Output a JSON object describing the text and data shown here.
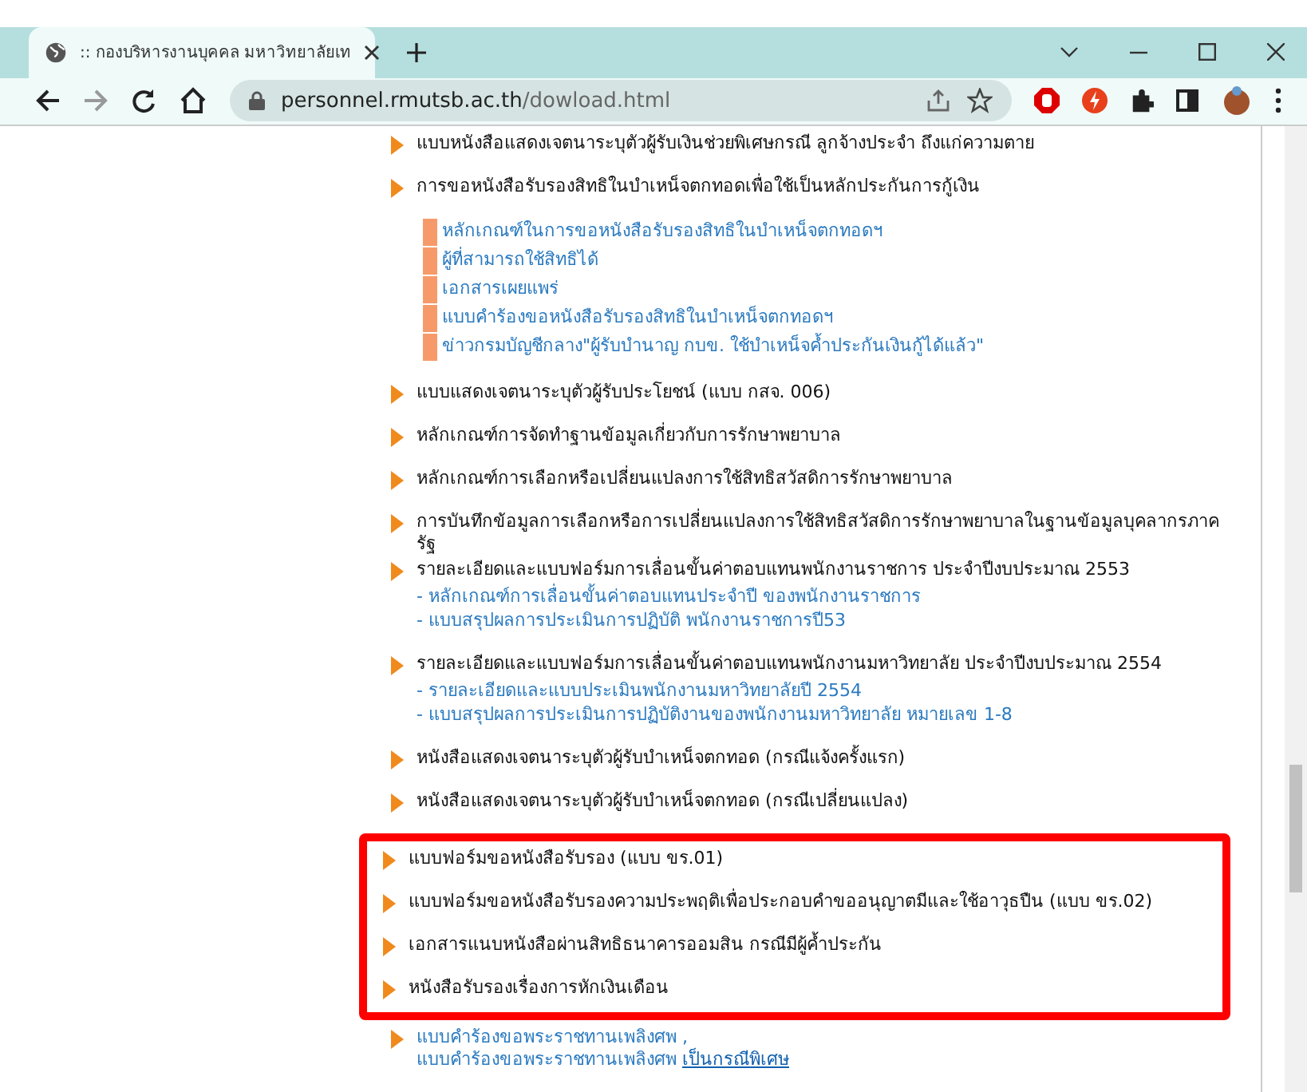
{
  "browser": {
    "tab_title": ":: กองบริหารงานบุคคล มหาวิทยาลัยเท",
    "url_host": "personnel.rmutsb.ac.th",
    "url_path": "/dowload.html",
    "forward_disabled": true
  },
  "items": [
    {
      "kind": "text",
      "highlighted": false,
      "lines": [
        "แบบหนังสือแสดงเจตนาระบุตัวผู้รับเงินช่วยพิเศษกรณี ลูกจ้างประจำ ถึงแก่ความตาย"
      ]
    },
    {
      "kind": "text",
      "highlighted": false,
      "lines": [
        "การขอหนังสือรับรองสิทธิในบำเหน็จตกทอดเพื่อใช้เป็นหลักประกันการกู้เงิน"
      ],
      "sublinks": [
        {
          "kind": "bar",
          "text": "หลักเกณฑ์ในการขอหนังสือรับรองสิทธิในบำเหน็จตกทอดฯ"
        },
        {
          "kind": "bar",
          "text": "ผู้ที่สามารถใช้สิทธิได้"
        },
        {
          "kind": "bar",
          "text": "เอกสารเผยแพร่"
        },
        {
          "kind": "bar",
          "text": "แบบคำร้องขอหนังสือรับรองสิทธิในบำเหน็จตกทอดฯ"
        },
        {
          "kind": "bar",
          "text": "ข่าวกรมบัญชีกลาง\"ผู้รับบำนาญ กบข. ใช้บำเหน็จค้ำประกันเงินกู้ได้แล้ว\""
        }
      ]
    },
    {
      "kind": "text",
      "highlighted": false,
      "lines": [
        "แบบแสดงเจตนาระบุตัวผู้รับประโยชน์ (แบบ กสจ. 006)"
      ]
    },
    {
      "kind": "text",
      "highlighted": false,
      "lines": [
        "หลักเกณฑ์การจัดทำฐานข้อมูลเกี่ยวกับการรักษาพยาบาล"
      ]
    },
    {
      "kind": "text",
      "highlighted": false,
      "lines": [
        "หลักเกณฑ์การเลือกหรือเปลี่ยนแปลงการใช้สิทธิสวัสดิการรักษาพยาบาล"
      ]
    },
    {
      "kind": "text",
      "highlighted": false,
      "lines": [
        "การบันทึกข้อมูลการเลือกหรือการเปลี่ยนแปลงการใช้สิทธิสวัสดิการรักษาพยาบาลในฐานข้อมูลบุคลากรภาค",
        "รัฐ"
      ]
    },
    {
      "kind": "text",
      "highlighted": false,
      "lines": [
        "รายละเอียดและแบบฟอร์มการเลื่อนขั้นค่าตอบแทนพนักงานราชการ ประจำปีงบประมาณ 2553"
      ],
      "sublinks": [
        {
          "kind": "dash",
          "text": "- หลักเกณฑ์การเลื่อนขั้นค่าตอบแทนประจำปี ของพนักงานราชการ"
        },
        {
          "kind": "dash",
          "text": "- แบบสรุปผลการประเมินการปฏิบัติ พนักงานราชการปี53"
        }
      ]
    },
    {
      "kind": "text",
      "highlighted": false,
      "lines": [
        "รายละเอียดและแบบฟอร์มการเลื่อนขั้นค่าตอบแทนพนักงานมหาวิทยาลัย ประจำปีงบประมาณ 2554"
      ],
      "sublinks": [
        {
          "kind": "dash",
          "text": "- รายละเอียดและแบบประเมินพนักงานมหาวิทยาลัยปี 2554"
        },
        {
          "kind": "dash",
          "text": "- แบบสรุปผลการประเมินการปฏิบัติงานของพนักงานมหาวิทยาลัย หมายเลข 1-8"
        }
      ]
    },
    {
      "kind": "text",
      "highlighted": false,
      "lines": [
        "หนังสือแสดงเจตนาระบุตัวผู้รับบำเหน็จตกทอด (กรณีแจ้งครั้งแรก)"
      ]
    },
    {
      "kind": "text",
      "highlighted": false,
      "lines": [
        "หนังสือแสดงเจตนาระบุตัวผู้รับบำเหน็จตกทอด (กรณีเปลี่ยนแปลง)"
      ]
    },
    {
      "kind": "text",
      "highlighted": true,
      "lines": [
        "แบบฟอร์มขอหนังสือรับรอง (แบบ ขร.01)"
      ]
    },
    {
      "kind": "text",
      "highlighted": true,
      "lines": [
        "แบบฟอร์มขอหนังสือรับรองความประพฤติเพื่อประกอบคำขออนุญาตมีและใช้อาวุธปืน (แบบ ขร.02)"
      ]
    },
    {
      "kind": "text",
      "highlighted": true,
      "lines": [
        "เอกสารแนบหนังสือผ่านสิทธิธนาคารออมสิน กรณีมีผู้ค้ำประกัน"
      ]
    },
    {
      "kind": "text",
      "highlighted": true,
      "lines": [
        "หนังสือรับรองเรื่องการหักเงินเดือน"
      ]
    },
    {
      "kind": "link",
      "highlighted": false,
      "lines": [
        "แบบคำร้องขอพระราชทานเพลิงศพ ,",
        "แบบคำร้องขอพระราชทานเพลิงศพ"
      ],
      "extra_link": "เป็นกรณีพิเศษ"
    }
  ]
}
